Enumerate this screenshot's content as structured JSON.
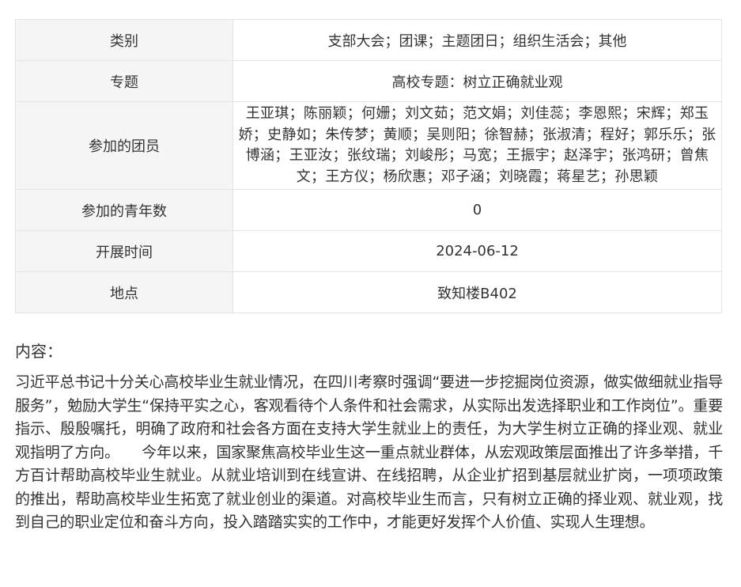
{
  "table": {
    "rows": [
      {
        "label": "类别",
        "value": "支部大会；团课；主题团日；组织生活会；其他"
      },
      {
        "label": "专题",
        "value": "高校专题：树立正确就业观"
      },
      {
        "label": "参加的团员",
        "value": "王亚琪；陈丽颖；何姗；刘文茹；范文娟；刘佳蕊；李恩熙；宋辉；郑玉娇；史静如；朱传梦；黄顺；吴则阳；徐智赫；张淑清；程好；郭乐乐；张博涵；王亚汝；张纹瑞；刘峻彤；马宽；王振宇；赵泽宇；张鸿研；曾焦文；王方仪；杨欣惠；邓子涵；刘晓霞；蒋星艺；孙思颖"
      },
      {
        "label": "参加的青年数",
        "value": "0"
      },
      {
        "label": "开展时间",
        "value": "2024-06-12"
      },
      {
        "label": "地点",
        "value": "致知楼B402"
      }
    ]
  },
  "content": {
    "title": "内容：",
    "text": "习近平总书记十分关心高校毕业生就业情况，在四川考察时强调“要进一步挖掘岗位资源，做实做细就业指导服务”，勉励大学生“保持平实之心，客观看待个人条件和社会需求，从实际出发选择职业和工作岗位”。重要指示、殷殷嘱托，明确了政府和社会各方面在支持大学生就业上的责任，为大学生树立正确的择业观、就业观指明了方向。　　今年以来，国家聚焦高校毕业生这一重点就业群体，从宏观政策层面推出了许多举措，千方百计帮助高校毕业生就业。从就业培训到在线宣讲、在线招聘，从企业扩招到基层就业扩岗，一项项政策的推出，帮助高校毕业生拓宽了就业创业的渠道。对高校毕业生而言，只有树立正确的择业观、就业观，找到自己的职业定位和奋斗方向，投入踏踏实实的工作中，才能更好发挥个人价值、实现人生理想。"
  }
}
